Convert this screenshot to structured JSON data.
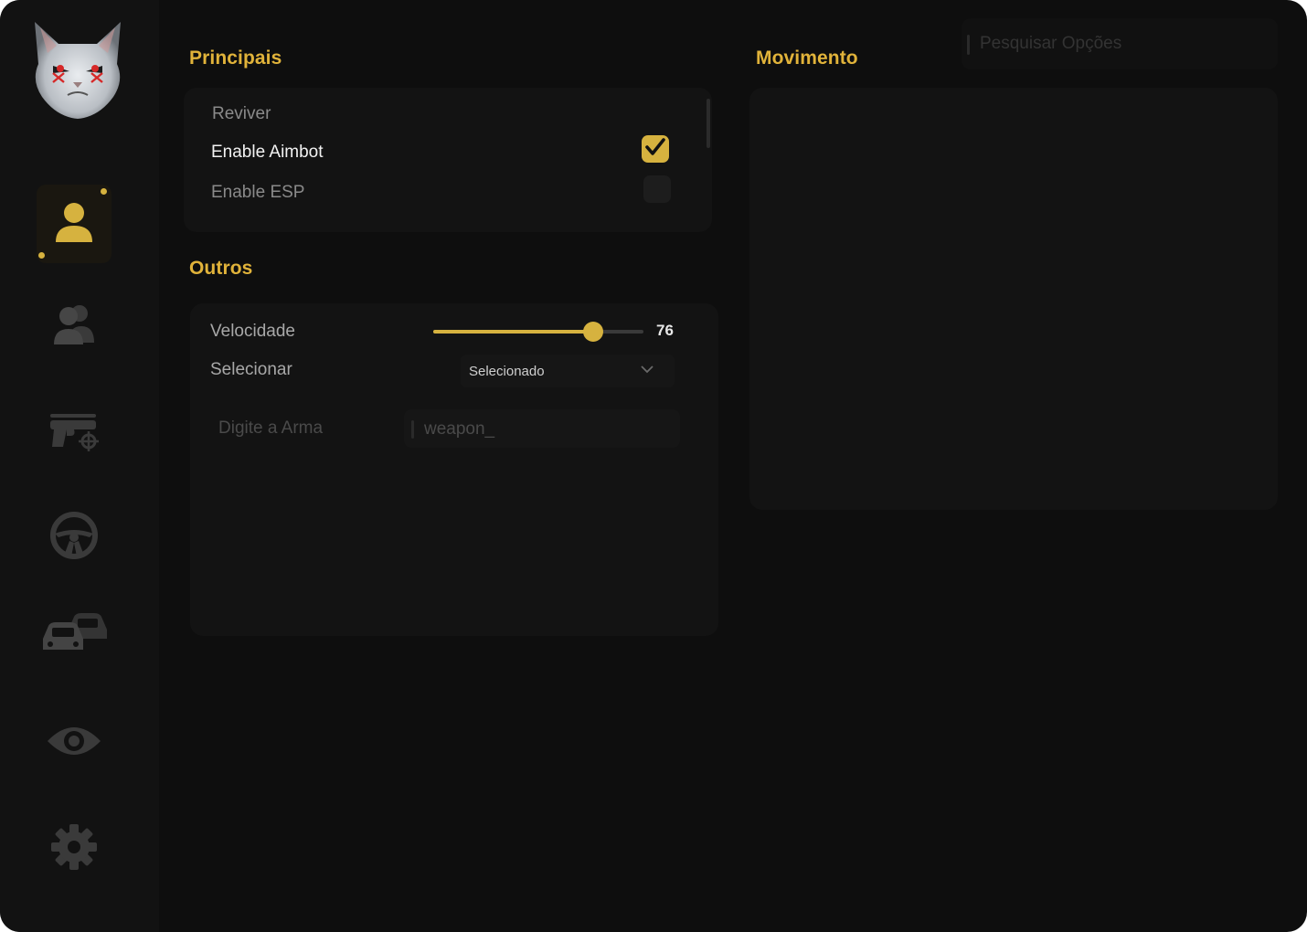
{
  "sections": {
    "principais": {
      "title": "Principais",
      "items": [
        {
          "label": "Reviver",
          "enabled": false,
          "has_checkbox": false
        },
        {
          "label": "Enable Aimbot",
          "enabled": true,
          "has_checkbox": true
        },
        {
          "label": "Enable ESP",
          "enabled": false,
          "has_checkbox": true
        }
      ]
    },
    "outros": {
      "title": "Outros",
      "slider": {
        "label": "Velocidade",
        "value": "76",
        "fraction": 0.76
      },
      "select": {
        "label": "Selecionar",
        "value": "Selecionado"
      },
      "input": {
        "label": "Digite a Arma",
        "value": "weapon_"
      }
    },
    "movimento": {
      "title": "Movimento"
    }
  },
  "search": {
    "placeholder": "Pesquisar Opções"
  },
  "sidebar": {
    "items": [
      {
        "icon": "user-icon",
        "active": true
      },
      {
        "icon": "users-icon",
        "active": false
      },
      {
        "icon": "gun-icon",
        "active": false
      },
      {
        "icon": "steering-wheel-icon",
        "active": false
      },
      {
        "icon": "cars-icon",
        "active": false
      },
      {
        "icon": "eye-icon",
        "active": false
      },
      {
        "icon": "gear-icon",
        "active": false
      }
    ]
  },
  "colors": {
    "accent": "#e1b33a",
    "background": "#0e0e0e",
    "panel": "#131313",
    "text_active": "#f2f2f2",
    "text_muted": "#8a8a8a"
  }
}
